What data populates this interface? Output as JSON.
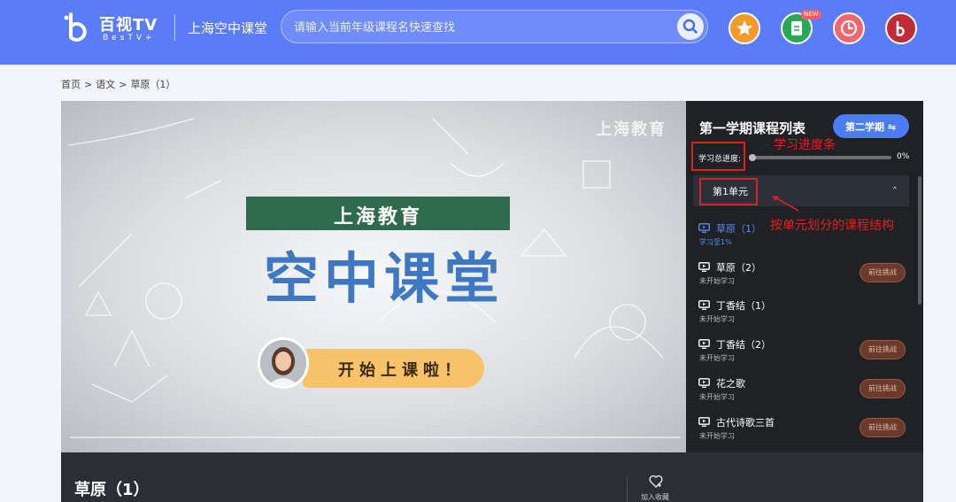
{
  "header": {
    "logo_cn": "百视TV",
    "logo_en": "BesTV+",
    "title": "上海空中课堂",
    "search_placeholder": "请输入当前年级课程名快速查找",
    "new_badge": "NEW"
  },
  "breadcrumb": [
    "首页",
    ">",
    "语文",
    ">",
    "草原（1）"
  ],
  "video": {
    "watermark": "上海教育",
    "banner": "上海教育",
    "big_title": "空中课堂",
    "start_text": "开始上课啦！"
  },
  "panel": {
    "title": "第一学期课程列表",
    "semester_button": "第二学期 ⇋",
    "progress_label": "学习总进度:",
    "progress_value": 0,
    "progress_percent": "0%",
    "unit_label": "第1单元",
    "lessons": [
      {
        "title": "草原（1）",
        "status": "学习至1%",
        "active": true,
        "challenge": ""
      },
      {
        "title": "草原（2）",
        "status": "未开始学习",
        "active": false,
        "challenge": "前往挑战"
      },
      {
        "title": "丁香结（1）",
        "status": "未开始学习",
        "active": false,
        "challenge": ""
      },
      {
        "title": "丁香结（2）",
        "status": "未开始学习",
        "active": false,
        "challenge": "前往挑战"
      },
      {
        "title": "花之歌",
        "status": "未开始学习",
        "active": false,
        "challenge": "前往挑战"
      },
      {
        "title": "古代诗歌三首",
        "status": "未开始学习",
        "active": false,
        "challenge": "前往挑战"
      }
    ]
  },
  "annotations": {
    "progress": "学习进度条",
    "structure": "按单元划分的课程结构"
  },
  "bottom": {
    "lesson_title": "草原（1）",
    "favorite_label": "加入收藏"
  },
  "colors": {
    "header_bg": "#5a7cf6",
    "panel_bg": "#1f2124",
    "active_lesson": "#5a8ef5",
    "annotation": "#e02020"
  }
}
